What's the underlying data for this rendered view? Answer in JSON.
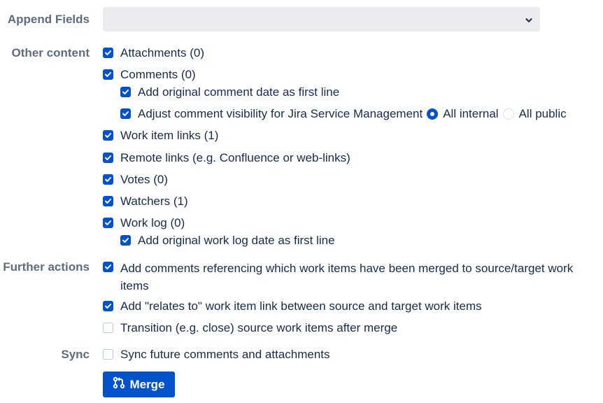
{
  "append_fields": {
    "label": "Append Fields",
    "selected_value": "",
    "icon": "chevron-down-icon"
  },
  "other_content": {
    "label": "Other content",
    "attachments": {
      "label": "Attachments (0)",
      "checked": true
    },
    "comments": {
      "label": "Comments (0)",
      "checked": true
    },
    "add_comment_date": {
      "label": "Add original comment date as first line",
      "checked": true
    },
    "adjust_visibility": {
      "label": "Adjust comment visibility for Jira Service Management",
      "checked": true,
      "options": [
        {
          "label": "All internal",
          "selected": true
        },
        {
          "label": "All public",
          "selected": false
        }
      ]
    },
    "work_item_links": {
      "label": "Work item links (1)",
      "checked": true
    },
    "remote_links": {
      "label": "Remote links (e.g. Confluence or web-links)",
      "checked": true
    },
    "votes": {
      "label": "Votes (0)",
      "checked": true
    },
    "watchers": {
      "label": "Watchers (1)",
      "checked": true
    },
    "work_log": {
      "label": "Work log (0)",
      "checked": true
    },
    "add_worklog_date": {
      "label": "Add original work log date as first line",
      "checked": true
    }
  },
  "further_actions": {
    "label": "Further actions",
    "add_comments": {
      "label_line1": "Add comments referencing which work items have been merged to source/target work",
      "label_line2": "items",
      "checked": true
    },
    "relates_to": {
      "label": "Add \"relates to\" work item link between source and target work items",
      "checked": true
    },
    "transition": {
      "label": "Transition (e.g. close) source work items after merge",
      "checked": false
    }
  },
  "sync": {
    "label": "Sync",
    "sync_future": {
      "label": "Sync future comments and attachments",
      "checked": false
    }
  },
  "merge_button": {
    "label": "Merge",
    "icon": "merge-icon"
  },
  "colors": {
    "primary": "#0052cc",
    "label": "#5e6c84",
    "text": "#172b4d",
    "select_bg": "#ebecf0"
  }
}
